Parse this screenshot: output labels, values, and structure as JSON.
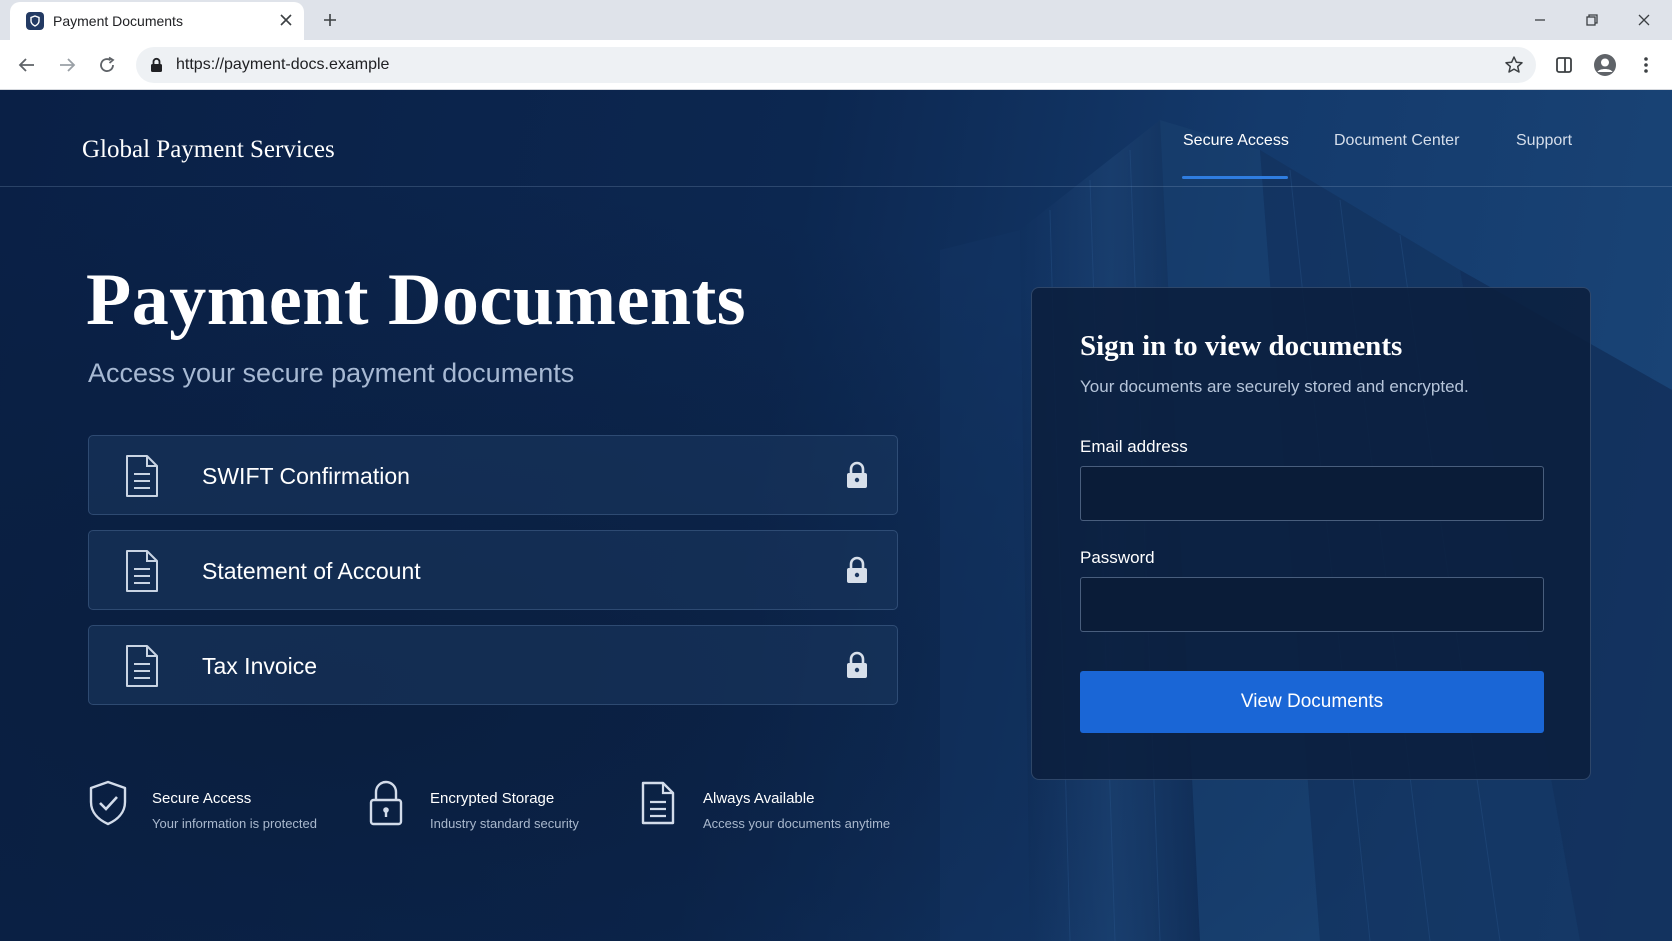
{
  "browser": {
    "tab_title": "Payment Documents",
    "url": "https://payment-docs.example"
  },
  "header": {
    "brand": "Global Payment Services",
    "nav": [
      {
        "label": "Secure Access",
        "active": true
      },
      {
        "label": "Document Center",
        "active": false
      },
      {
        "label": "Support",
        "active": false
      }
    ]
  },
  "hero": {
    "title": "Payment Documents",
    "subtitle": "Access your secure payment documents"
  },
  "documents": [
    {
      "label": "SWIFT Confirmation",
      "icon": "document-icon",
      "status_icon": "lock-icon"
    },
    {
      "label": "Statement of Account",
      "icon": "document-icon",
      "status_icon": "lock-icon"
    },
    {
      "label": "Tax Invoice",
      "icon": "document-icon",
      "status_icon": "lock-icon"
    }
  ],
  "features": [
    {
      "title": "Secure Access",
      "description": "Your information is protected",
      "icon": "shield-check-icon"
    },
    {
      "title": "Encrypted Storage",
      "description": "Industry standard security",
      "icon": "lock-icon"
    },
    {
      "title": "Always Available",
      "description": "Access your documents anytime",
      "icon": "document-icon"
    }
  ],
  "login": {
    "title": "Sign in to view documents",
    "subtitle": "Your documents are securely stored and encrypted.",
    "email_label": "Email address",
    "email_value": "",
    "password_label": "Password",
    "password_value": "",
    "submit_label": "View Documents"
  },
  "colors": {
    "page_bg": "#0b2347",
    "accent": "#1a66d6",
    "nav_underline": "#2f7de0"
  }
}
